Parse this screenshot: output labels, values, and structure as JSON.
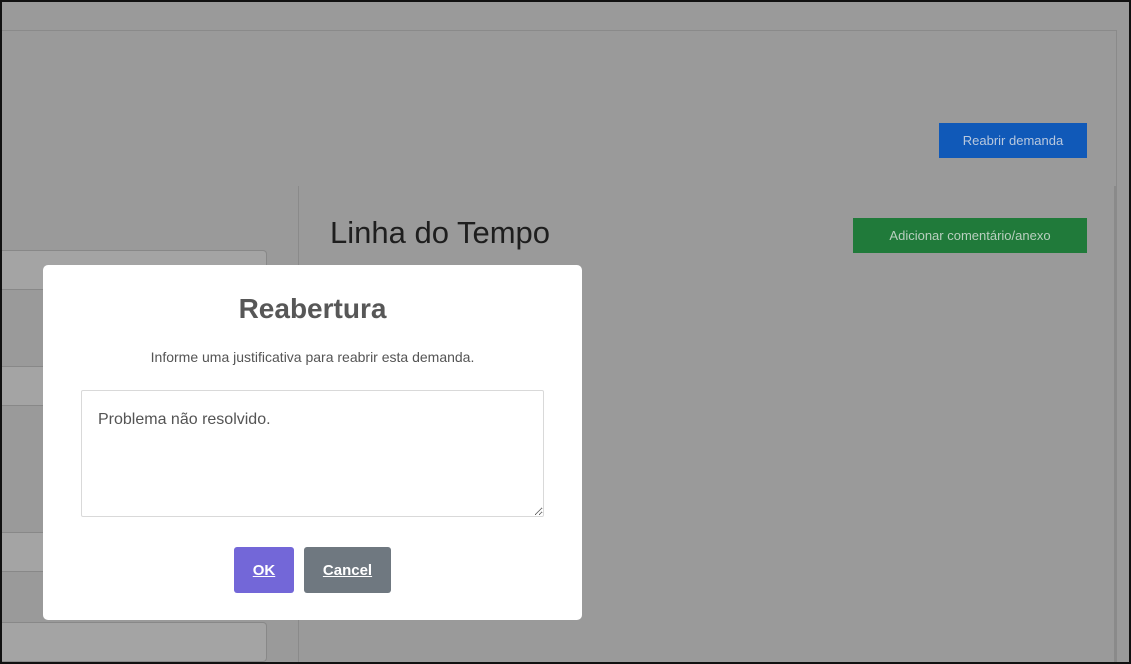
{
  "page": {
    "reopen_button": "Reabrir demanda",
    "timeline_title": "Linha do Tempo",
    "add_comment_button": "Adicionar comentário/anexo"
  },
  "modal": {
    "title": "Reabertura",
    "message": "Informe uma justificativa para reabrir esta demanda.",
    "textarea_value": "Problema não resolvido.",
    "ok_label": "OK",
    "cancel_label": "Cancel"
  },
  "colors": {
    "overlay": "#9a9a9a",
    "reopen_button": "#1059b8",
    "add_button": "#207a3a",
    "ok_button": "#7367d8",
    "cancel_button": "#6f7880"
  }
}
